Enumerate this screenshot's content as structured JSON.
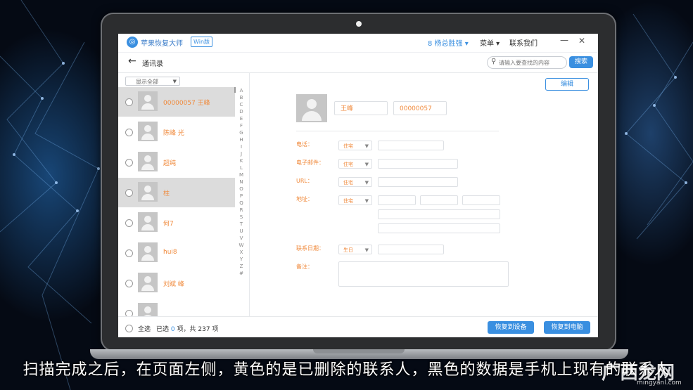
{
  "app": {
    "title": "苹果恢复大师",
    "edition": "Win版",
    "user": "8 杨总胜强 ▾",
    "menu": "菜单 ▾",
    "contact": "联系我们",
    "minimize": "—",
    "close": "✕"
  },
  "toolbar": {
    "back": "←",
    "title": "通讯录",
    "search_placeholder": "请输入要查找的内容",
    "search_button": "搜索"
  },
  "left": {
    "filter": "显示全部",
    "alphabet": [
      "A",
      "B",
      "C",
      "D",
      "E",
      "F",
      "G",
      "H",
      "I",
      "J",
      "K",
      "L",
      "M",
      "N",
      "O",
      "P",
      "Q",
      "R",
      "S",
      "T",
      "U",
      "V",
      "W",
      "X",
      "Y",
      "Z",
      "#"
    ],
    "contacts": [
      {
        "name": "00000057 王峰",
        "selected": true
      },
      {
        "name": "陈峰 光",
        "selected": false
      },
      {
        "name": "超纯",
        "selected": false
      },
      {
        "name": "柱",
        "selected": true
      },
      {
        "name": "何7",
        "selected": false
      },
      {
        "name": "hui8",
        "selected": false
      },
      {
        "name": "刘斌 峰",
        "selected": false
      },
      {
        "name": "",
        "selected": false
      }
    ]
  },
  "right": {
    "edit_button": "编辑",
    "first_name": "王峰",
    "number": "00000057",
    "fields": [
      {
        "label": "电话：",
        "select": "住宅"
      },
      {
        "label": "电子邮件：",
        "select": "住宅"
      },
      {
        "label": "URL：",
        "select": "住宅"
      },
      {
        "label": "地址：",
        "select": "住宅"
      },
      {
        "label": "联系日期：",
        "select": "生日"
      },
      {
        "label": "备注：",
        "select": ""
      }
    ]
  },
  "footer": {
    "select_all": "全选",
    "selected_prefix": "已选",
    "selected_count": "0",
    "selected_suffix": "项，共 237 项",
    "restore_device": "恢复到设备",
    "restore_pc": "恢复到电脑"
  },
  "caption": "扫描完成之后，在页面左侧，黄色的是已删除的联系人，黑色的数据是手机上现有的联系人",
  "watermark": "广西龙网",
  "watermark_url": "mingyanl.com"
}
